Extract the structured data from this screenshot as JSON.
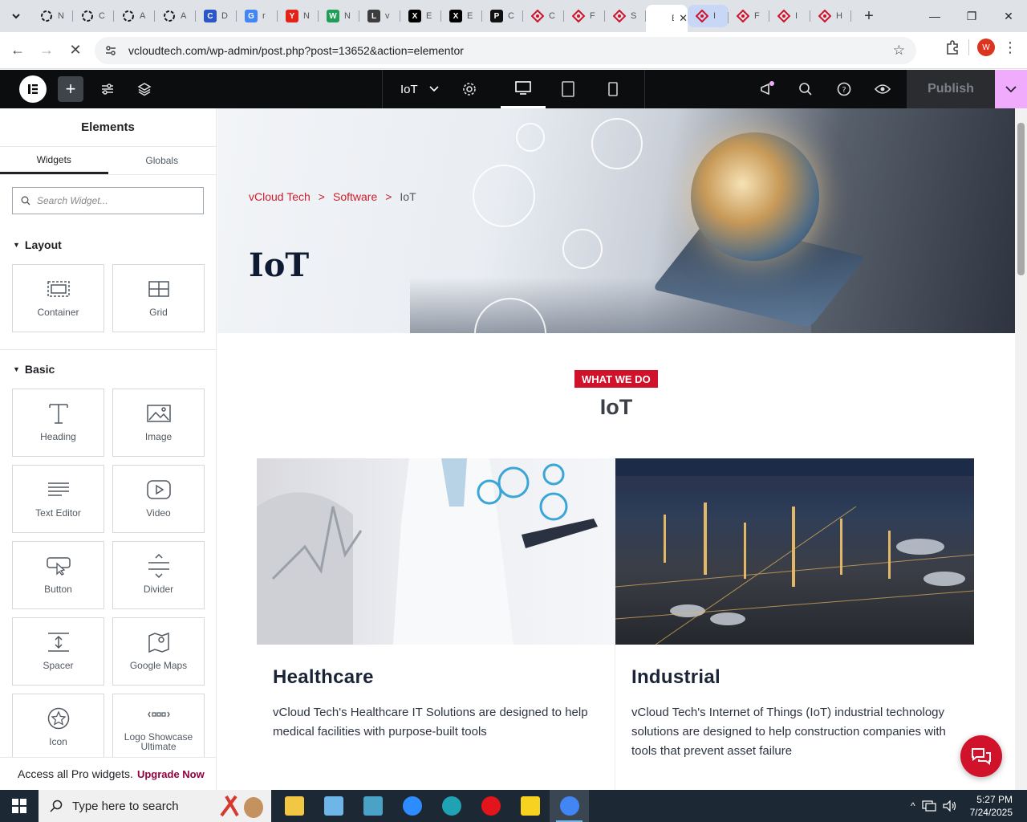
{
  "browser": {
    "tabs": [
      {
        "icon": "openai-icon",
        "label": "N",
        "color": "#1a1a1a"
      },
      {
        "icon": "openai-icon",
        "label": "C",
        "color": "#1a1a1a"
      },
      {
        "icon": "openai-icon",
        "label": "A",
        "color": "#1a1a1a"
      },
      {
        "icon": "openai-icon",
        "label": "A",
        "color": "#1a1a1a"
      },
      {
        "icon": "chatgpt-icon",
        "label": "D",
        "color": "#2b56c9"
      },
      {
        "icon": "google-icon",
        "label": "r",
        "color": "#4285f4"
      },
      {
        "icon": "youtube-icon",
        "label": "N",
        "color": "#e62117"
      },
      {
        "icon": "w-icon",
        "label": "N",
        "color": "#1f9e55"
      },
      {
        "icon": "linkedin-icon",
        "label": "v",
        "color": "#3d3d3d"
      },
      {
        "icon": "x-icon",
        "label": "E",
        "color": "#000000"
      },
      {
        "icon": "x-icon",
        "label": "E",
        "color": "#000000"
      },
      {
        "icon": "perplexity-icon",
        "label": "C",
        "color": "#111111"
      },
      {
        "icon": "diamond-icon",
        "label": "C",
        "color": "#d0122b"
      },
      {
        "icon": "diamond-icon",
        "label": "F",
        "color": "#d0122b"
      },
      {
        "icon": "diamond-icon",
        "label": "S",
        "color": "#d0122b"
      },
      {
        "icon": "elementor-tab-icon",
        "label": "E",
        "color": "#ffffff",
        "active": true
      },
      {
        "icon": "diamond-icon",
        "label": "I",
        "color": "#d0122b",
        "highlight": true
      },
      {
        "icon": "diamond-icon",
        "label": "F",
        "color": "#d0122b"
      },
      {
        "icon": "diamond-icon",
        "label": "I",
        "color": "#d0122b"
      },
      {
        "icon": "diamond-icon",
        "label": "H",
        "color": "#d0122b"
      }
    ],
    "url": "vcloudtech.com/wp-admin/post.php?post=13652&action=elementor",
    "profile_initial": "W"
  },
  "editor": {
    "page_name": "IoT",
    "publish_label": "Publish"
  },
  "panel": {
    "title": "Elements",
    "tabs": [
      "Widgets",
      "Globals"
    ],
    "search_placeholder": "Search Widget...",
    "sections": [
      {
        "title": "Layout",
        "widgets": [
          {
            "label": "Container",
            "icon": "container-icon"
          },
          {
            "label": "Grid",
            "icon": "grid-icon"
          }
        ]
      },
      {
        "title": "Basic",
        "widgets": [
          {
            "label": "Heading",
            "icon": "heading-icon"
          },
          {
            "label": "Image",
            "icon": "image-icon"
          },
          {
            "label": "Text Editor",
            "icon": "text-editor-icon"
          },
          {
            "label": "Video",
            "icon": "video-icon"
          },
          {
            "label": "Button",
            "icon": "button-icon"
          },
          {
            "label": "Divider",
            "icon": "divider-icon"
          },
          {
            "label": "Spacer",
            "icon": "spacer-icon"
          },
          {
            "label": "Google Maps",
            "icon": "map-icon"
          },
          {
            "label": "Icon",
            "icon": "star-icon"
          },
          {
            "label": "Logo Showcase Ultimate",
            "icon": "logo-showcase-icon"
          }
        ]
      }
    ],
    "promo_text": "Access all Pro widgets.",
    "promo_link": "Upgrade Now"
  },
  "page": {
    "breadcrumb": [
      "vCloud Tech",
      ">",
      "Software",
      ">",
      "IoT"
    ],
    "hero_title": "IoT",
    "badge": "WHAT WE DO",
    "section_title": "IoT",
    "cards": [
      {
        "title": "Healthcare",
        "text": "vCloud Tech's Healthcare IT Solutions are designed to help medical facilities with purpose-built tools"
      },
      {
        "title": "Industrial",
        "text": "vCloud Tech's Internet of Things (IoT) industrial technology solutions are designed to help construction companies with tools that prevent asset failure"
      }
    ],
    "accent_color": "#d0122b"
  },
  "taskbar": {
    "search_placeholder": "Type here to search",
    "apps": [
      "file-explorer-icon",
      "snipping-icon",
      "app-icon",
      "zoom-icon",
      "edge-icon",
      "opera-icon",
      "sticky-notes-icon",
      "chrome-icon"
    ],
    "time": "5:27 PM",
    "date": "7/24/2025"
  }
}
